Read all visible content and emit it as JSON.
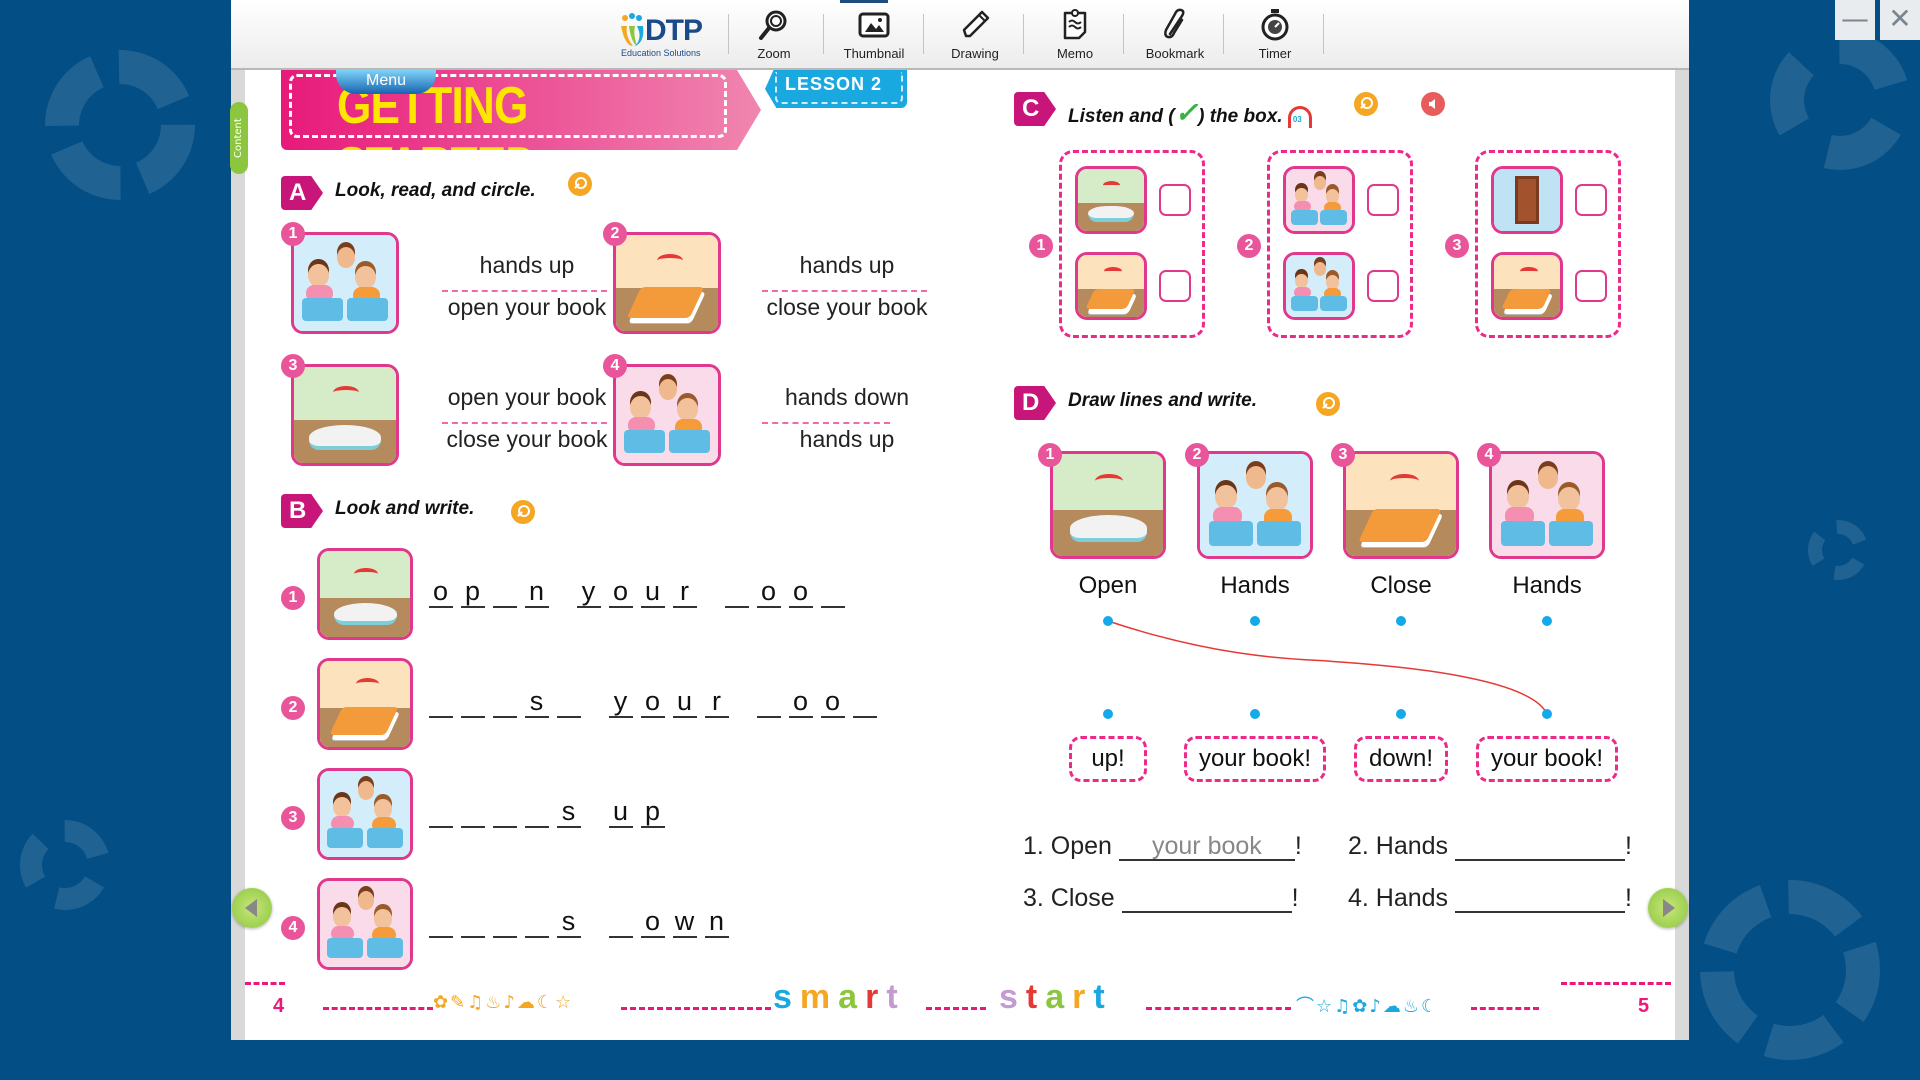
{
  "window": {
    "minimize_label": "—",
    "close_label": "✕"
  },
  "toolbar": {
    "logo_text": "DTP",
    "logo_subtitle": "Education Solutions",
    "items": [
      {
        "label": "Zoom",
        "icon": "magnifier-icon"
      },
      {
        "label": "Thumbnail",
        "icon": "image-icon"
      },
      {
        "label": "Drawing",
        "icon": "pencil-icon"
      },
      {
        "label": "Memo",
        "icon": "memo-clipboard-icon"
      },
      {
        "label": "Bookmark",
        "icon": "paperclip-icon"
      },
      {
        "label": "Timer",
        "icon": "stopwatch-icon"
      }
    ],
    "active_item": "Thumbnail"
  },
  "sidebar": {
    "content_tab_label": "Content"
  },
  "header": {
    "menu_label": "Menu",
    "title": "GETTING STARTED",
    "lesson_label": "LESSON 2"
  },
  "section_a": {
    "letter": "A",
    "instruction": "Look, read, and circle.",
    "items": [
      {
        "number": "1",
        "picture": "children-hands-up",
        "options": [
          "hands up",
          "open your book"
        ]
      },
      {
        "number": "2",
        "picture": "closing-book",
        "options": [
          "hands up",
          "close your book"
        ]
      },
      {
        "number": "3",
        "picture": "opening-book",
        "options": [
          "open your book",
          "close your book"
        ]
      },
      {
        "number": "4",
        "picture": "children-hands-down",
        "options": [
          "hands down",
          "hands up"
        ]
      }
    ]
  },
  "section_b": {
    "letter": "B",
    "instruction": "Look and write.",
    "items": [
      {
        "number": "1",
        "picture": "opening-book",
        "words": [
          [
            "o",
            "p",
            "_",
            "n"
          ],
          [
            "y",
            "o",
            "u",
            "r"
          ],
          [
            "_",
            "o",
            "o",
            "_"
          ]
        ]
      },
      {
        "number": "2",
        "picture": "closing-book",
        "words": [
          [
            "_",
            "_",
            "_",
            "s",
            "_"
          ],
          [
            "y",
            "o",
            "u",
            "r"
          ],
          [
            "_",
            "o",
            "o",
            "_"
          ]
        ]
      },
      {
        "number": "3",
        "picture": "children-hands-up",
        "words": [
          [
            "_",
            "_",
            "_",
            "_",
            "s"
          ],
          [
            "u",
            "p"
          ]
        ]
      },
      {
        "number": "4",
        "picture": "children-hands-down",
        "words": [
          [
            "_",
            "_",
            "_",
            "_",
            "s"
          ],
          [
            "_",
            "o",
            "w",
            "n"
          ]
        ]
      }
    ]
  },
  "section_c": {
    "letter": "C",
    "instruction_before": "Listen and (",
    "check_mark": "✓",
    "instruction_after": ") the box.",
    "audio_track": "03",
    "groups": [
      {
        "number": "1",
        "pictures": [
          "opening-book",
          "closing-book"
        ],
        "checked": [
          false,
          false
        ]
      },
      {
        "number": "2",
        "pictures": [
          "children-hands-down",
          "children-hands-up"
        ],
        "checked": [
          false,
          false
        ]
      },
      {
        "number": "3",
        "pictures": [
          "opening-door",
          "closing-book"
        ],
        "checked": [
          false,
          false
        ]
      }
    ]
  },
  "section_d": {
    "letter": "D",
    "instruction": "Draw lines and write.",
    "pictures": [
      {
        "number": "1",
        "picture": "opening-book",
        "word": "Open"
      },
      {
        "number": "2",
        "picture": "children-hands-up",
        "word": "Hands"
      },
      {
        "number": "3",
        "picture": "closing-book",
        "word": "Close"
      },
      {
        "number": "4",
        "picture": "children-hands-down",
        "word": "Hands"
      }
    ],
    "answers": [
      "up!",
      "your book!",
      "down!",
      "your book!"
    ],
    "drawn_connection": {
      "from_picture": 1,
      "to_answer": 4
    },
    "sentences": [
      {
        "prefix": "1. Open",
        "filled": "your book",
        "suffix": "!"
      },
      {
        "prefix": "2. Hands",
        "filled": "",
        "suffix": "!"
      },
      {
        "prefix": "3. Close",
        "filled": "",
        "suffix": "!"
      },
      {
        "prefix": "4. Hands",
        "filled": "",
        "suffix": "!"
      }
    ]
  },
  "footer": {
    "left_page": "4",
    "right_page": "5",
    "brand_word_1": "smart",
    "brand_word_2": "start",
    "left_doodles": "✿✎♫♨♪☁☾☆",
    "right_doodles": "⌒☆♫✿♪☁♨☾"
  },
  "colors": {
    "background": "#024e85",
    "accent_pink": "#e8197a",
    "title_yellow": "#ffe600",
    "lesson_blue": "#1aa8e0",
    "dot_blue": "#14a9ea",
    "line_red": "#e53935",
    "nav_green": "#8cc63f",
    "key_orange": "#f5a623"
  }
}
